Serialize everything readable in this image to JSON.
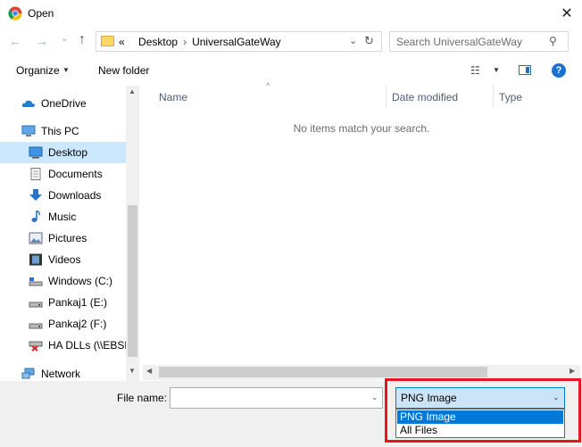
{
  "window": {
    "title": "Open",
    "close_glyph": "✕"
  },
  "nav": {
    "back_glyph": "←",
    "forward_glyph": "→",
    "recent_glyph": "⌄",
    "up_glyph": "↑",
    "address": {
      "prefix": "«",
      "crumbs": [
        "Desktop",
        "UniversalGateWay"
      ],
      "sep": "›"
    },
    "refresh_glyph": "↻",
    "address_chevron": "⌄",
    "search": {
      "placeholder": "Search UniversalGateWay",
      "icon_glyph": "⚲"
    }
  },
  "toolbar": {
    "organize_label": "Organize",
    "organize_arrow": "▼",
    "new_folder_label": "New folder",
    "view_glyph": "☷",
    "view_arrow": "▼",
    "help_glyph": "?"
  },
  "sidebar": {
    "items": [
      {
        "label": "OneDrive",
        "icon": "cloud-icon"
      },
      {
        "label": "This PC",
        "icon": "computer-icon"
      },
      {
        "label": "Desktop",
        "icon": "desktop-icon",
        "selected": true
      },
      {
        "label": "Documents",
        "icon": "documents-icon"
      },
      {
        "label": "Downloads",
        "icon": "download-icon"
      },
      {
        "label": "Music",
        "icon": "music-icon"
      },
      {
        "label": "Pictures",
        "icon": "pictures-icon"
      },
      {
        "label": "Videos",
        "icon": "videos-icon"
      },
      {
        "label": "Windows (C:)",
        "icon": "drive-icon"
      },
      {
        "label": "Pankaj1 (E:)",
        "icon": "drive-icon"
      },
      {
        "label": "Pankaj2 (F:)",
        "icon": "drive-icon"
      },
      {
        "label": "HA DLLs (\\\\EBSD",
        "icon": "network-drive-disconnected-icon"
      },
      {
        "label": "Network",
        "icon": "network-icon"
      }
    ],
    "scroll_up": "▲",
    "scroll_down": "▼"
  },
  "list": {
    "columns": [
      "Name",
      "Date modified",
      "Type"
    ],
    "sort_glyph": "^",
    "empty_message": "No items match your search.",
    "scroll_left": "◀",
    "scroll_right": "▶"
  },
  "bottom": {
    "file_name_label": "File name:",
    "file_name_value": "",
    "file_name_arrow": "⌄",
    "file_type": {
      "selected": "PNG Image",
      "arrow": "⌄",
      "options": [
        "PNG Image",
        "All Files"
      ]
    }
  },
  "colors": {
    "accent": "#0078d7",
    "selection": "#cce8ff",
    "highlight_box": "#e8141e"
  }
}
